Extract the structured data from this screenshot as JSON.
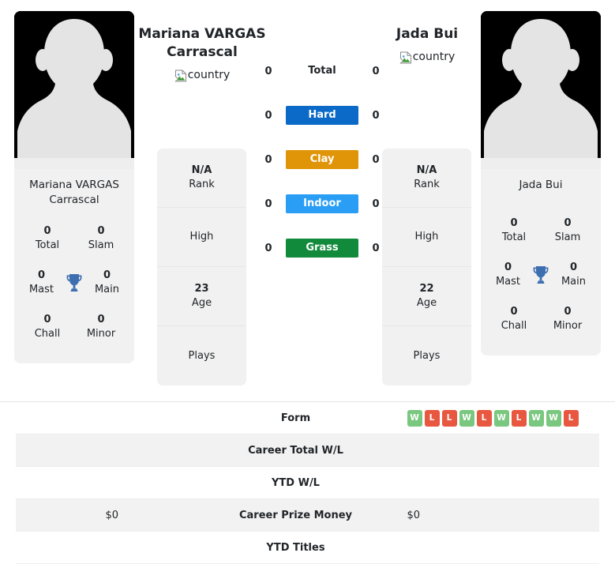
{
  "players": {
    "left": {
      "name": "Mariana VARGAS Carrascal",
      "name_line1": "Mariana VARGAS",
      "name_line2": "Carrascal",
      "country_alt": "country",
      "avatar_name": "player-avatar-placeholder",
      "card_name_line1": "Mariana VARGAS",
      "card_name_line2": "Carrascal",
      "titles": [
        {
          "value": "0",
          "label": "Total"
        },
        {
          "value": "0",
          "label": "Slam"
        },
        {
          "value": "0",
          "label": "Mast"
        },
        {
          "value": "0",
          "label": "Main"
        },
        {
          "value": "0",
          "label": "Chall"
        },
        {
          "value": "0",
          "label": "Minor"
        }
      ],
      "info": [
        {
          "value": "N/A",
          "label": "Rank"
        },
        {
          "value": "",
          "label": "High"
        },
        {
          "value": "23",
          "label": "Age"
        },
        {
          "value": "",
          "label": "Plays"
        }
      ],
      "prize_money": "$0"
    },
    "right": {
      "name": "Jada Bui",
      "name_line1": "Jada Bui",
      "name_line2": "",
      "country_alt": "country",
      "avatar_name": "player-avatar-placeholder",
      "card_name_line1": "Jada Bui",
      "card_name_line2": "",
      "titles": [
        {
          "value": "0",
          "label": "Total"
        },
        {
          "value": "0",
          "label": "Slam"
        },
        {
          "value": "0",
          "label": "Mast"
        },
        {
          "value": "0",
          "label": "Main"
        },
        {
          "value": "0",
          "label": "Chall"
        },
        {
          "value": "0",
          "label": "Minor"
        }
      ],
      "info": [
        {
          "value": "N/A",
          "label": "Rank"
        },
        {
          "value": "",
          "label": "High"
        },
        {
          "value": "22",
          "label": "Age"
        },
        {
          "value": "",
          "label": "Plays"
        }
      ],
      "prize_money": "$0"
    }
  },
  "surfaces": [
    {
      "label": "Total",
      "left": "0",
      "right": "0",
      "color": "transparent",
      "plain": true
    },
    {
      "label": "Hard",
      "left": "0",
      "right": "0",
      "color": "#0b69c7",
      "plain": false
    },
    {
      "label": "Clay",
      "left": "0",
      "right": "0",
      "color": "#e09407",
      "plain": false
    },
    {
      "label": "Indoor",
      "left": "0",
      "right": "0",
      "color": "#2a9df4",
      "plain": false
    },
    {
      "label": "Grass",
      "left": "0",
      "right": "0",
      "color": "#128a3c",
      "plain": false
    }
  ],
  "table": {
    "rows": [
      {
        "label": "Form",
        "left": "",
        "right": "",
        "shaded": false,
        "type": "form"
      },
      {
        "label": "Career Total W/L",
        "left": "",
        "right": "",
        "shaded": true,
        "type": "text"
      },
      {
        "label": "YTD W/L",
        "left": "",
        "right": "",
        "shaded": false,
        "type": "text"
      },
      {
        "label": "Career Prize Money",
        "left": "$0",
        "right": "$0",
        "shaded": true,
        "type": "text"
      },
      {
        "label": "YTD Titles",
        "left": "",
        "right": "",
        "shaded": false,
        "type": "text"
      }
    ],
    "form_sequence": [
      "W",
      "L",
      "L",
      "W",
      "L",
      "W",
      "L",
      "W",
      "W",
      "L"
    ]
  },
  "colors": {
    "win": "#7ac77f",
    "loss": "#e8573f",
    "hard": "#0b69c7",
    "clay": "#e09407",
    "indoor": "#2a9df4",
    "grass": "#128a3c",
    "trophy": "#3d6fb0",
    "card_bg": "#f1f1f1",
    "row_shaded": "#f2f2f2"
  }
}
